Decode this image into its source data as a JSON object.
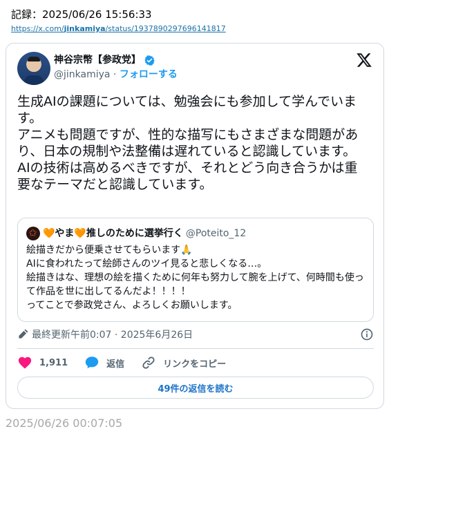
{
  "record": {
    "label": "記録：2025/06/26 15:56:33",
    "url_prefix": "https://x.com/",
    "url_user": "jinkamiya",
    "url_suffix": "/status/1937890297696141817"
  },
  "tweet": {
    "author_name": "神谷宗幣【参政党】",
    "handle": "@jinkamiya",
    "separator": " · ",
    "follow_label": "フォローする",
    "text": "生成AIの課題については、勉強会にも参加して学んでいます。\nアニメも問題ですが、性的な描写にもさまざまな問題があり、日本の規制や法整備は遅れていると認識しています。\nAIの技術は高めるべきですが、それとどう向き合うかは重要なテーマだと認識しています。",
    "quote": {
      "name": "🧡やま🧡推しのために選挙行く",
      "handle": "@Poteito_12",
      "text": "絵描きだから便乗させてもらいます🙏\nAIに食われたって絵師さんのツイ見ると悲しくなる…。\n絵描きはな、理想の絵を描くために何年も努力して腕を上げて、何時間も使って作品を世に出してるんだよ！！！！\nってことで参政党さん、よろしくお願いします。"
    },
    "edited_label": "最終更新午前0:07 · 2025年6月26日",
    "likes": "1,911",
    "reply_label": "返信",
    "copy_link_label": "リンクをコピー",
    "read_replies_label": "49件の返信を読む"
  },
  "footer": {
    "timestamp": "2025/06/26 00:07:05"
  },
  "colors": {
    "accent": "#1d9bf0",
    "like": "#f91880",
    "text": "#0f1419",
    "muted": "#536471",
    "border": "#cfd9de"
  },
  "icons": {
    "verified": "verified-badge-icon",
    "x_logo": "x-logo-icon",
    "pencil": "pencil-icon",
    "info": "info-icon",
    "heart": "heart-icon",
    "reply": "speech-bubble-icon",
    "link": "link-icon"
  }
}
